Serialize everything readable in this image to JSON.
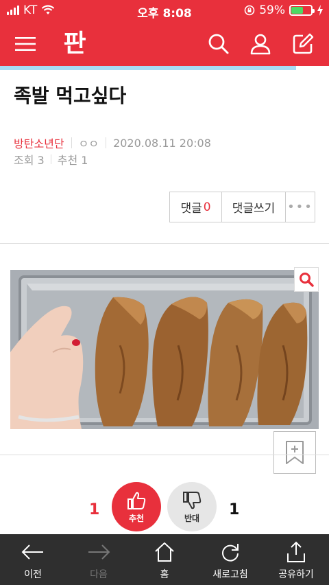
{
  "status": {
    "carrier": "KT",
    "time": "오후 8:08",
    "battery_percent": "59%",
    "battery_level": 0.59
  },
  "header": {
    "logo_text": "판",
    "icons": [
      "menu-icon",
      "search-icon",
      "user-icon",
      "edit-icon"
    ]
  },
  "reading_progress": 0.9,
  "article": {
    "title": "족발 먹고싶다",
    "author": "방탄소년단",
    "author_extra": "ㅇㅇ",
    "datetime": "2020.08.11 20:08",
    "views_label": "조회 3",
    "recommend_label": "추천 1"
  },
  "actions": {
    "comments_label": "댓글",
    "comments_count": "0",
    "write_comment_label": "댓글쓰기",
    "more_label": "•••"
  },
  "vote": {
    "up_count": "1",
    "up_label": "추천",
    "down_label": "반대",
    "down_count": "1"
  },
  "toolbar": {
    "prev": "이전",
    "next": "다음",
    "home": "홈",
    "refresh": "새로고침",
    "share": "공유하기"
  },
  "colors": {
    "brand_red": "#e8303c",
    "toolbar_bg": "#2f2f2f"
  }
}
